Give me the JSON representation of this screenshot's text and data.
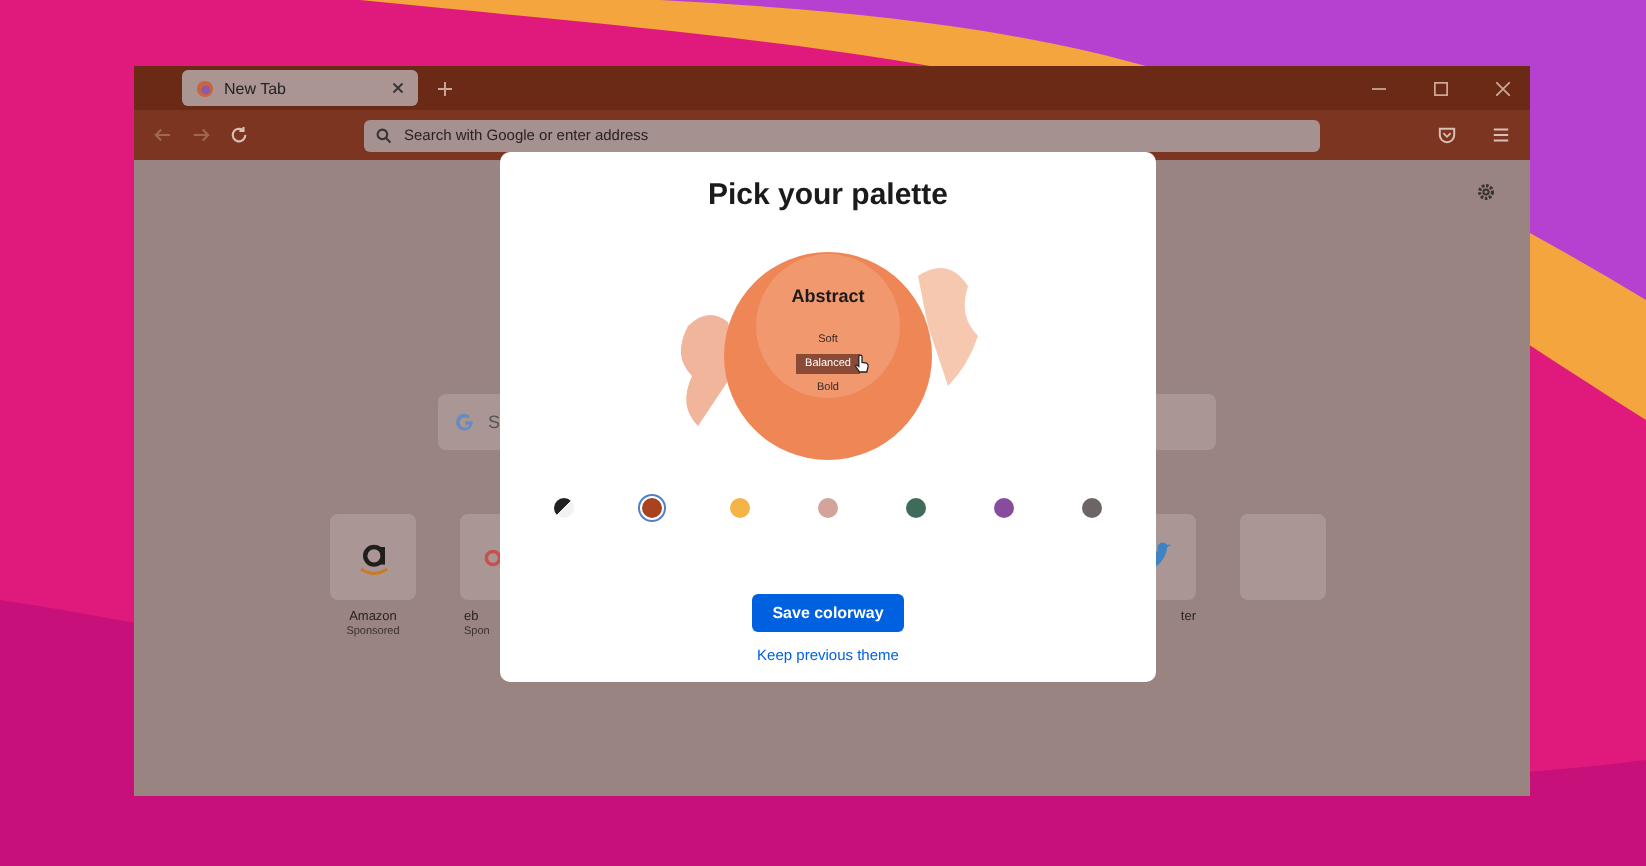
{
  "browser": {
    "tab": {
      "title": "New Tab"
    },
    "address_bar": {
      "placeholder": "Search with Google or enter address"
    }
  },
  "new_tab": {
    "search": {
      "value": "S"
    },
    "shortcuts_left": [
      {
        "kind": "amazon",
        "label": "Amazon",
        "sublabel": "Sponsored"
      },
      {
        "kind": "ebay",
        "label": "eb",
        "sublabel": "Spon"
      }
    ],
    "shortcuts_right": [
      {
        "kind": "twitter",
        "label": "ter"
      },
      {
        "kind": "blank"
      }
    ]
  },
  "modal": {
    "title": "Pick your palette",
    "illustration": {
      "title": "Abstract"
    },
    "intensities": [
      {
        "label": "Soft",
        "selected": false
      },
      {
        "label": "Balanced",
        "selected": true
      },
      {
        "label": "Bold",
        "selected": false
      }
    ],
    "swatches": [
      {
        "kind": "split",
        "color": "#222222",
        "selected": false
      },
      {
        "kind": "solid",
        "color": "#a9431f",
        "selected": true
      },
      {
        "kind": "solid",
        "color": "#f5b446",
        "selected": false
      },
      {
        "kind": "solid",
        "color": "#d4a49c",
        "selected": false
      },
      {
        "kind": "solid",
        "color": "#3f6b5a",
        "selected": false
      },
      {
        "kind": "solid",
        "color": "#874d9c",
        "selected": false
      },
      {
        "kind": "solid",
        "color": "#6b6665",
        "selected": false
      }
    ],
    "primary_button": "Save colorway",
    "link": "Keep previous theme"
  }
}
